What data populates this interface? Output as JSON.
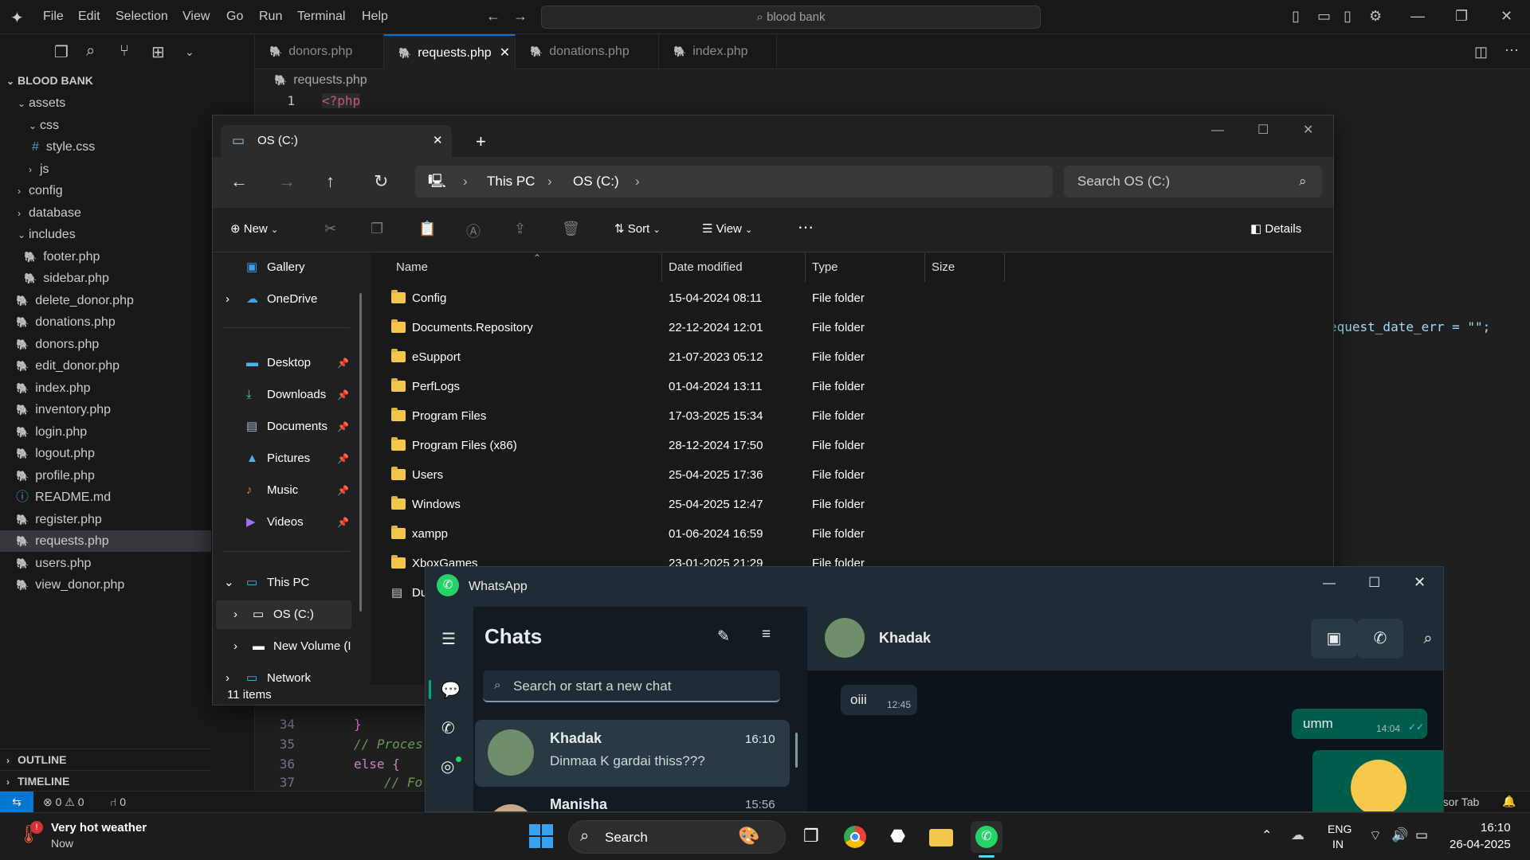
{
  "vscode": {
    "menu": [
      "File",
      "Edit",
      "Selection",
      "View",
      "Go",
      "Run",
      "Terminal",
      "Help"
    ],
    "command_center": "blood bank",
    "explorer_root": "BLOOD BANK",
    "tree": {
      "assets": "assets",
      "css": "css",
      "style_css": "style.css",
      "js": "js",
      "config": "config",
      "database": "database",
      "includes": "includes",
      "footer": "footer.php",
      "sidebar": "sidebar.php",
      "delete_donor": "delete_donor.php",
      "donations": "donations.php",
      "donors": "donors.php",
      "edit_donor": "edit_donor.php",
      "index": "index.php",
      "inventory": "inventory.php",
      "login": "login.php",
      "logout": "logout.php",
      "profile": "profile.php",
      "readme": "README.md",
      "register": "register.php",
      "requests": "requests.php",
      "users": "users.php",
      "view_donor": "view_donor.php"
    },
    "outline": "OUTLINE",
    "timeline": "TIMELINE",
    "tabs": [
      "donors.php",
      "requests.php",
      "donations.php",
      "index.php"
    ],
    "breadcrumb": "requests.php",
    "code": {
      "line1_num": "1",
      "line1": "<?php",
      "right_snippet": "equest_date_err = \"\";",
      "ln34": "34",
      "ln35": "35",
      "ln36": "36",
      "ln37": "37",
      "c34": "}",
      "c35": "// Proces",
      "c36": "else {",
      "c37": "// Fo"
    },
    "status": {
      "errors": "0",
      "warnings": "0",
      "ports": "0",
      "right": "rsor Tab"
    }
  },
  "explorer": {
    "tab_title": "OS (C:)",
    "address": [
      "This PC",
      "OS (C:)"
    ],
    "search_placeholder": "Search OS (C:)",
    "toolbar": {
      "new": "New",
      "sort": "Sort",
      "view": "View",
      "details": "Details"
    },
    "nav": {
      "gallery": "Gallery",
      "onedrive": "OneDrive",
      "desktop": "Desktop",
      "downloads": "Downloads",
      "documents": "Documents",
      "pictures": "Pictures",
      "music": "Music",
      "videos": "Videos",
      "this_pc": "This PC",
      "os_c": "OS (C:)",
      "new_volume": "New Volume (I",
      "network": "Network"
    },
    "columns": [
      "Name",
      "Date modified",
      "Type",
      "Size"
    ],
    "files": [
      {
        "name": "Config",
        "date": "15-04-2024 08:11",
        "type": "File folder"
      },
      {
        "name": "Documents.Repository",
        "date": "22-12-2024 12:01",
        "type": "File folder"
      },
      {
        "name": "eSupport",
        "date": "21-07-2023 05:12",
        "type": "File folder"
      },
      {
        "name": "PerfLogs",
        "date": "01-04-2024 13:11",
        "type": "File folder"
      },
      {
        "name": "Program Files",
        "date": "17-03-2025 15:34",
        "type": "File folder"
      },
      {
        "name": "Program Files (x86)",
        "date": "28-12-2024 17:50",
        "type": "File folder"
      },
      {
        "name": "Users",
        "date": "25-04-2025 17:36",
        "type": "File folder"
      },
      {
        "name": "Windows",
        "date": "25-04-2025 12:47",
        "type": "File folder"
      },
      {
        "name": "xampp",
        "date": "01-06-2024 16:59",
        "type": "File folder"
      },
      {
        "name": "XboxGames",
        "date": "23-01-2025 21:29",
        "type": "File folder"
      },
      {
        "name": "Du",
        "date": "",
        "type": ""
      }
    ],
    "status": "11 items"
  },
  "whatsapp": {
    "title": "WhatsApp",
    "chats_heading": "Chats",
    "search_placeholder": "Search or start a new chat",
    "chats": [
      {
        "name": "Khadak",
        "time": "16:10",
        "preview": "Dinmaa K gardai thiss???"
      },
      {
        "name": "Manisha",
        "time": "15:56",
        "preview": ""
      }
    ],
    "active_contact": "Khadak",
    "messages": [
      {
        "text": "oiii",
        "time": "12:45",
        "dir": "in"
      },
      {
        "text": "umm",
        "time": "14:04",
        "dir": "out"
      }
    ],
    "colors": {
      "outgoing": "#005c4b",
      "incoming": "#202c33",
      "accent": "#00a884"
    }
  },
  "taskbar": {
    "weather_title": "Very hot weather",
    "weather_sub": "Now",
    "search": "Search",
    "lang1": "ENG",
    "lang2": "IN",
    "time": "16:10",
    "date": "26-04-2025"
  }
}
